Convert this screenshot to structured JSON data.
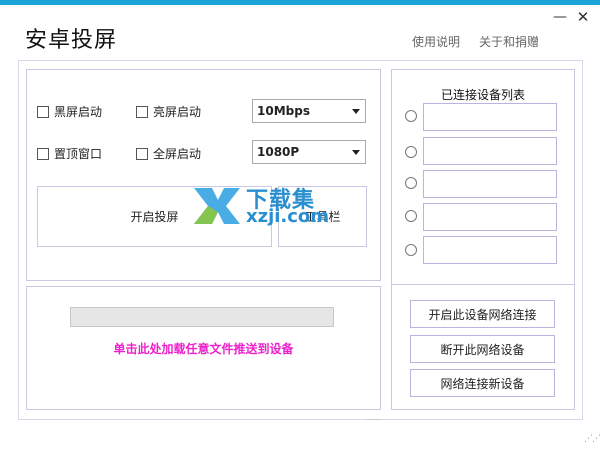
{
  "window": {
    "title": "安卓投屏",
    "minimize_label": "—",
    "close_label": "✕",
    "accent_color": "#1aa4d8"
  },
  "header_links": {
    "help": "使用说明",
    "about": "关于和捐赠"
  },
  "options": {
    "black_start": "黑屏启动",
    "bright_start": "亮屏启动",
    "topmost": "置顶窗口",
    "fullscreen": "全屏启动"
  },
  "selects": {
    "bitrate": "10Mbps",
    "resolution": "1080P"
  },
  "buttons": {
    "start_cast": "开启投屏",
    "toolbar": "工具栏"
  },
  "watermark": {
    "cn": "下载集",
    "en": "xzji.com"
  },
  "upload": {
    "hint": "单击此处加载任意文件推送到设备",
    "hint_color": "#ee22cc"
  },
  "device_list": {
    "title": "已连接设备列表",
    "devices": [
      "",
      "",
      "",
      "",
      ""
    ]
  },
  "actions": {
    "open_network": "开启此设备网络连接",
    "disconnect": "断开此网络设备",
    "connect_new": "网络连接新设备"
  }
}
